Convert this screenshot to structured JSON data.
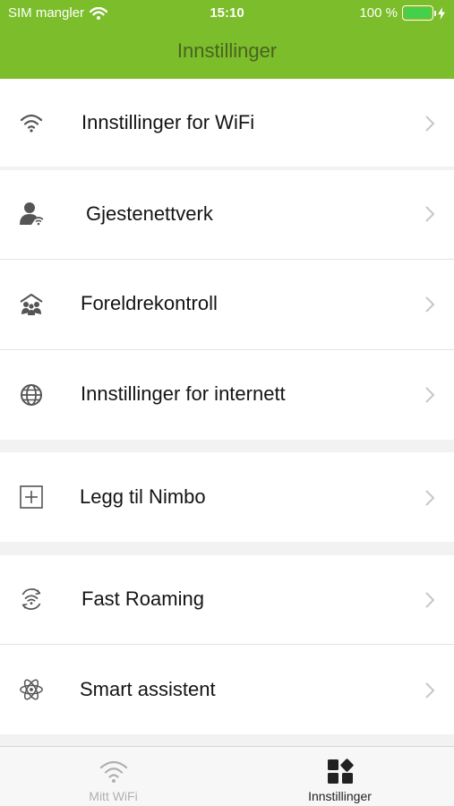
{
  "status_bar": {
    "carrier": "SIM mangler",
    "time": "15:10",
    "battery": "100 %",
    "battery_level": 1.0
  },
  "nav": {
    "title": "Innstillinger"
  },
  "settings_items": [
    {
      "label": "Innstillinger for WiFi",
      "icon": "wifi-icon"
    },
    {
      "label": "Gjestenettverk",
      "icon": "guest-user-icon"
    },
    {
      "label": "Foreldrekontroll",
      "icon": "family-icon"
    },
    {
      "label": "Innstillinger for internett",
      "icon": "globe-icon"
    },
    {
      "label": "Legg til Nimbo",
      "icon": "plus-square-icon"
    },
    {
      "label": "Fast Roaming",
      "icon": "roaming-icon"
    },
    {
      "label": "Smart assistent",
      "icon": "atom-icon"
    }
  ],
  "tab_bar": {
    "tabs": [
      {
        "label": "Mitt WiFi",
        "icon": "wifi-icon",
        "active": false
      },
      {
        "label": "Innstillinger",
        "icon": "dashboard-icon",
        "active": true
      }
    ]
  },
  "colors": {
    "header": "#7bbd2a",
    "title": "#4a6320",
    "icon": "#555555",
    "chevron": "#c7c7cc",
    "tab_active": "#222222",
    "tab_inactive": "#b0b0b0"
  }
}
